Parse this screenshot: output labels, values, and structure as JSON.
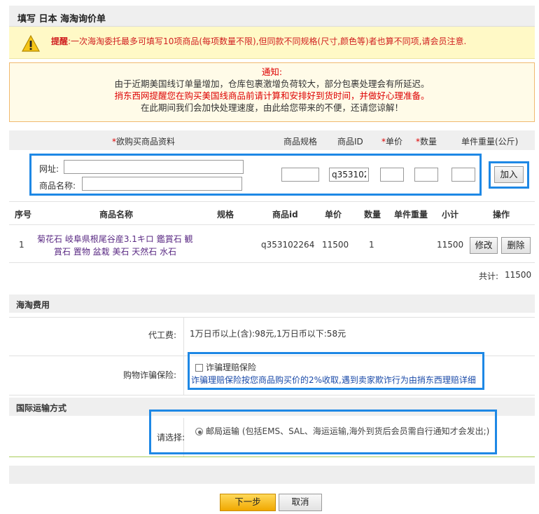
{
  "page_title": "填写 日本 海淘询价单",
  "warning": {
    "label": "提醒",
    "text": ":一次海淘委托最多可填写10项商品(每项数量不限),但同款不同规格(尺寸,颜色等)者也算不同项,请会员注意."
  },
  "notice": {
    "title": "通知:",
    "line1": "由于近期美国线订单量增加，仓库包裹激增负荷较大，部分包裹处理会有所延迟。",
    "line2": "捎东西网提醒您在购买美国线商品前请计算和安排好到货时间，并做好心理准备。",
    "line3": "在此期间我们会加快处理速度，由此给您带来的不便，还请您谅解！"
  },
  "form": {
    "col_info_req": "*",
    "col_info": "欲购买商品资料",
    "col_spec": "商品规格",
    "col_id": "商品ID",
    "col_price_req": "*",
    "col_price": "单价",
    "col_qty_req": "*",
    "col_qty": "数量",
    "col_weight": "单件重量(公斤)",
    "url_label": "网址:",
    "url_value": "",
    "name_label": "商品名称:",
    "name_value": "",
    "spec_value": "",
    "id_value": "q353102",
    "price_value": "",
    "qty_value": "",
    "weight_value": "",
    "add_button": "加入"
  },
  "list": {
    "headers": {
      "no": "序号",
      "name": "商品名称",
      "spec": "规格",
      "id": "商品id",
      "price": "单价",
      "qty": "数量",
      "weight": "单件重量",
      "subtotal": "小计",
      "action": "操作"
    },
    "rows": [
      {
        "no": "1",
        "name_line1": "菊花石 岐阜県根尾谷産3.1キロ 鑑賞石 観",
        "name_line2": "賞石 置物 盆栽 美石 天然石 水石",
        "spec": "",
        "id": "q353102264",
        "price": "11500",
        "qty": "1",
        "weight": "",
        "subtotal": "11500",
        "edit": "修改",
        "delete": "删除"
      }
    ],
    "total_label": "共计:",
    "total_value": "11500"
  },
  "fees": {
    "section_title": "海淘费用",
    "service_label": "代工费:",
    "service_value": "1万日币以上(含):98元,1万日币以下:58元",
    "insurance_label": "购物诈骗保险:",
    "insurance_checkbox": "诈骗理赔保险",
    "insurance_desc": "诈骗理赔保险按您商品购买价的2%收取,遇到卖家欺诈行为由捎东西理赔",
    "insurance_link": "详细"
  },
  "shipping": {
    "section_title": "国际运输方式",
    "select_label": "请选择:",
    "option_label": "邮局运输",
    "option_desc": "(包括EMS、SAL、海运运输,海外到货后会员需自行通知才会发出;)"
  },
  "buttons": {
    "next": "下一步",
    "cancel": "取消"
  },
  "colors": {
    "highlight_box": "#1e88e5",
    "warning_bg": "#fff9c6",
    "notice_border": "#f0b970",
    "alert_red": "#d00000",
    "item_link": "#5b2b84",
    "next_button": "#f5b820"
  }
}
